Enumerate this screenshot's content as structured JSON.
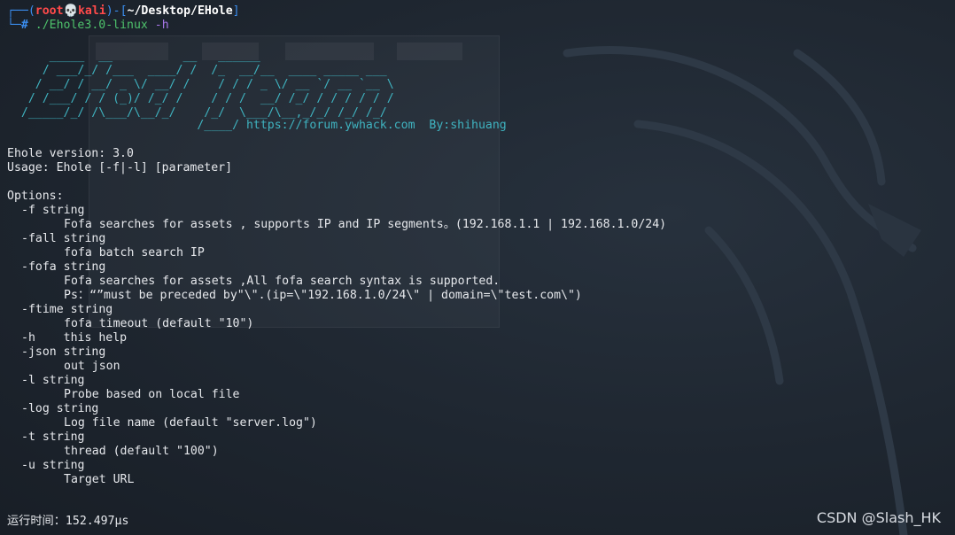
{
  "prompt": {
    "line1_prefix": "┌──(",
    "user": "root",
    "skull": "💀",
    "host": "kali",
    "line1_mid": ")-[",
    "path": "~/Desktop/EHole",
    "line1_end": "]",
    "line2_prefix": "└─",
    "hash": "#",
    "command": "./Ehole3.0-linux",
    "flag": "-h"
  },
  "banner": {
    "art": [
      "      _____  __          __   ______",
      "     / ___/_/ /___  ____/ /  /_  __/__  ____ _____ ___",
      "    / __/ / __/ _ \\/ __/ /    / / / _ \\/ __ `/ __ `__ \\",
      "   / /___/ / / (_)/ /_/ /    / / /  __/ /_/ / / / / / /",
      "  /_____/_/ /\\___/\\__/_/    /_/  \\___/\\__,_/_/ /_/ /_/"
    ],
    "footer_prefix": "                           /____/ ",
    "url": "https://forum.ywhack.com",
    "author": "By:shihuang"
  },
  "help": {
    "version": "Ehole version: 3.0",
    "usage": "Usage: Ehole [-f|-l] [parameter]",
    "options_header": "Options:",
    "options": [
      {
        "flag": "-f string",
        "desc": "Fofa searches for assets , supports IP and IP segments。(192.168.1.1 | 192.168.1.0/24)"
      },
      {
        "flag": "-fall string",
        "desc": "fofa batch search IP"
      },
      {
        "flag": "-fofa string",
        "desc": "Fofa searches for assets ,All fofa search syntax is supported."
      },
      {
        "flag": "",
        "desc": "Ps：“”must be preceded by\"\\\".(ip=\\\"192.168.1.0/24\\\" | domain=\\\"test.com\\\")"
      },
      {
        "flag": "-ftime string",
        "desc": "fofa timeout (default \"10\")"
      },
      {
        "flag": "-h    this help",
        "desc": ""
      },
      {
        "flag": "-json string",
        "desc": "out json"
      },
      {
        "flag": "-l string",
        "desc": "Probe based on local file"
      },
      {
        "flag": "-log string",
        "desc": "Log file name (default \"server.log\")"
      },
      {
        "flag": "-t string",
        "desc": "thread (default \"100\")"
      },
      {
        "flag": "-u string",
        "desc": "Target URL"
      }
    ]
  },
  "runtime": "运行时间：152.497µs",
  "watermark": "CSDN @Slash_HK",
  "colors": {
    "background": "#1d2530",
    "prompt_blue": "#3b8ef0",
    "prompt_red": "#ff4a4a",
    "command_green": "#4ec26b",
    "banner_cyan": "#3fb3c0",
    "text": "#e6e8ec"
  }
}
